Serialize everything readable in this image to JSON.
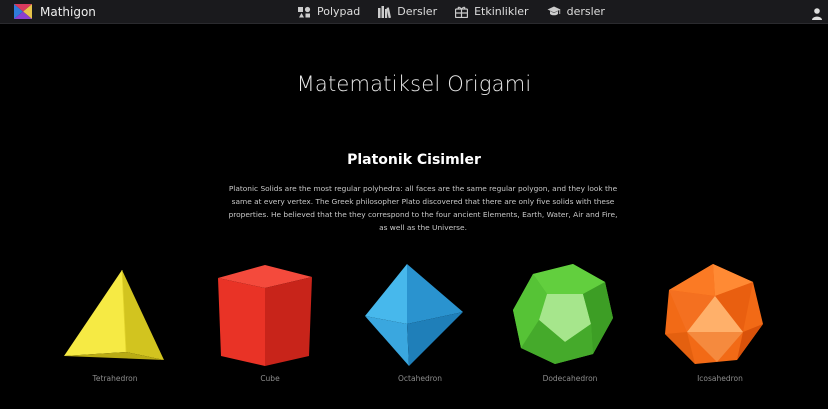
{
  "nav": {
    "brand": "Mathigon",
    "links": [
      {
        "label": "Polypad",
        "icon": "polypad-icon"
      },
      {
        "label": "Dersler",
        "icon": "lessons-icon"
      },
      {
        "label": "Etkinlikler",
        "icon": "activities-icon"
      },
      {
        "label": "dersler",
        "icon": "graduation-cap-icon"
      }
    ],
    "user_icon": "user-icon"
  },
  "page": {
    "title": "Matematiksel Origami"
  },
  "section": {
    "title": "Platonik Cisimler",
    "description": "Platonic Solids are the most regular polyhedra: all faces are the same regular polygon, and they look the same at every vertex. The Greek philosopher Plato discovered that there are only five solids with these properties. He believed that the they correspond to the four ancient Elements, Earth, Water, Air and Fire, as well as the Universe."
  },
  "solids": [
    {
      "name": "Tetrahedron",
      "color": "#f2e63a"
    },
    {
      "name": "Cube",
      "color": "#e8352c"
    },
    {
      "name": "Octahedron",
      "color": "#2fa6e0"
    },
    {
      "name": "Dodecahedron",
      "color": "#5fcb3a"
    },
    {
      "name": "Icosahedron",
      "color": "#f57a22"
    }
  ],
  "colors": {
    "background": "#000000",
    "navbar": "#1a1a1d",
    "label": "#8d8d8d"
  }
}
